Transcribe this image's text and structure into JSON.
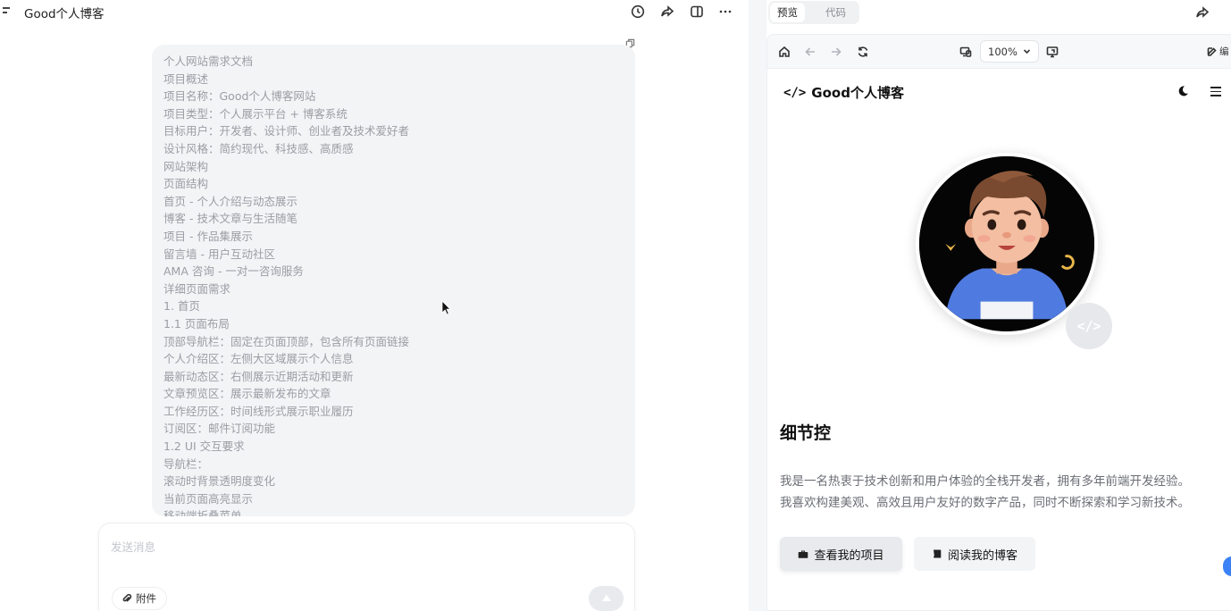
{
  "app": {
    "title": "Good个人博客"
  },
  "toolbar": {
    "history": "clock-icon",
    "share": "share-icon",
    "layout": "split-panel-icon",
    "more": "more-icon"
  },
  "message": {
    "lines": [
      "个人网站需求文档",
      "项目概述",
      "项目名称：Good个人博客网站",
      "项目类型：个人展示平台 + 博客系统",
      "目标用户：开发者、设计师、创业者及技术爱好者",
      "设计风格：简约现代、科技感、高质感",
      "网站架构",
      "页面结构",
      "首页 - 个人介绍与动态展示",
      "博客 - 技术文章与生活随笔",
      "项目 - 作品集展示",
      "留言墙 - 用户互动社区",
      "AMA 咨询 - 一对一咨询服务",
      "详细页面需求",
      "1. 首页",
      "1.1 页面布局",
      "顶部导航栏：固定在页面顶部，包含所有页面链接",
      "个人介绍区：左侧大区域展示个人信息",
      "最新动态区：右侧展示近期活动和更新",
      "文章预览区：展示最新发布的文章",
      "工作经历区：时间线形式展示职业履历",
      "订阅区：邮件订阅功能",
      "1.2 UI 交互要求",
      "导航栏：",
      "滚动时背景透明度变化",
      "当前页面高亮显示",
      "移动端折叠菜单"
    ]
  },
  "composer": {
    "placeholder": "发送消息",
    "attach_label": "附件"
  },
  "preview": {
    "tabs": {
      "preview": "预览",
      "code": "代码"
    },
    "zoom": "100%",
    "edit_label": "编",
    "site": {
      "brand_icon": "</>",
      "brand_name": "Good个人博客",
      "badge_icon": "</>",
      "headline": "细节控",
      "bio_line1": "我是一名热衷于技术创新和用户体验的全栈开发者，拥有多年前端开发经验。",
      "bio_line2": "我喜欢构建美观、高效且用户友好的数字产品，同时不断探索和学习新技术。",
      "primary_button": "查看我的项目",
      "secondary_button": "阅读我的博客"
    }
  },
  "colors": {
    "message_bg": "#f3f4f6",
    "muted_text": "#9a9da4",
    "avatar_bg": "#050505",
    "shirt": "#4f7ae0",
    "accent_blue": "#3b82f6"
  }
}
